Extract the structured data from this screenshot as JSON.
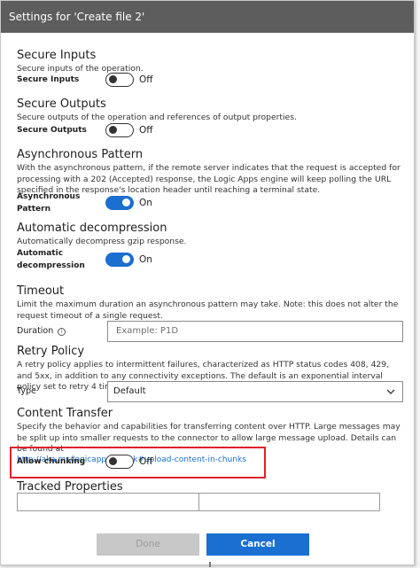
{
  "dialog": {
    "title": "Settings for 'Create file 2'"
  },
  "secure_inputs": {
    "title": "Secure Inputs",
    "description": "Secure inputs of the operation.",
    "label": "Secure Inputs",
    "state": "Off"
  },
  "secure_outputs": {
    "title": "Secure Outputs",
    "description": "Secure outputs of the operation and references of output properties.",
    "label": "Secure Outputs",
    "state": "Off"
  },
  "async_pattern": {
    "title": "Asynchronous Pattern",
    "description": "With the asynchronous pattern, if the remote server indicates that the request is accepted for processing with a 202 (Accepted) response, the Logic Apps engine will keep polling the URL specified in the response's location header until reaching a terminal state.",
    "label": "Asynchronous Pattern",
    "state": "On"
  },
  "auto_decompress": {
    "title": "Automatic decompression",
    "description": "Automatically decompress gzip response.",
    "label_line1": "Automatic",
    "label_line2": "decompression",
    "state": "On"
  },
  "timeout": {
    "title": "Timeout",
    "description": "Limit the maximum duration an asynchronous pattern may take. Note: this does not alter the request timeout of a single request.",
    "label": "Duration",
    "placeholder": "Example: P1D"
  },
  "retry_policy": {
    "title": "Retry Policy",
    "description": "A retry policy applies to intermittent failures, characterized as HTTP status codes 408, 429, and 5xx, in addition to any connectivity exceptions. The default is an exponential interval policy set to retry 4 times.",
    "label": "Type",
    "value": "Default"
  },
  "content_transfer": {
    "title": "Content Transfer",
    "description": "Specify the behavior and capabilities for transferring content over HTTP. Large messages may be split up into smaller requests to the connector to allow large message upload. Details can be found at",
    "link": "http://aka.ms/logicapps-chunk#upload-content-in-chunks",
    "label": "Allow chunking",
    "state": "Off"
  },
  "tracked_properties": {
    "title": "Tracked Properties"
  },
  "footer": {
    "done_label": "Done",
    "cancel_label": "Cancel"
  },
  "colors": {
    "accent": "#1a6fd1",
    "highlight": "#e0202a",
    "titlebar": "#5d5d5d"
  }
}
